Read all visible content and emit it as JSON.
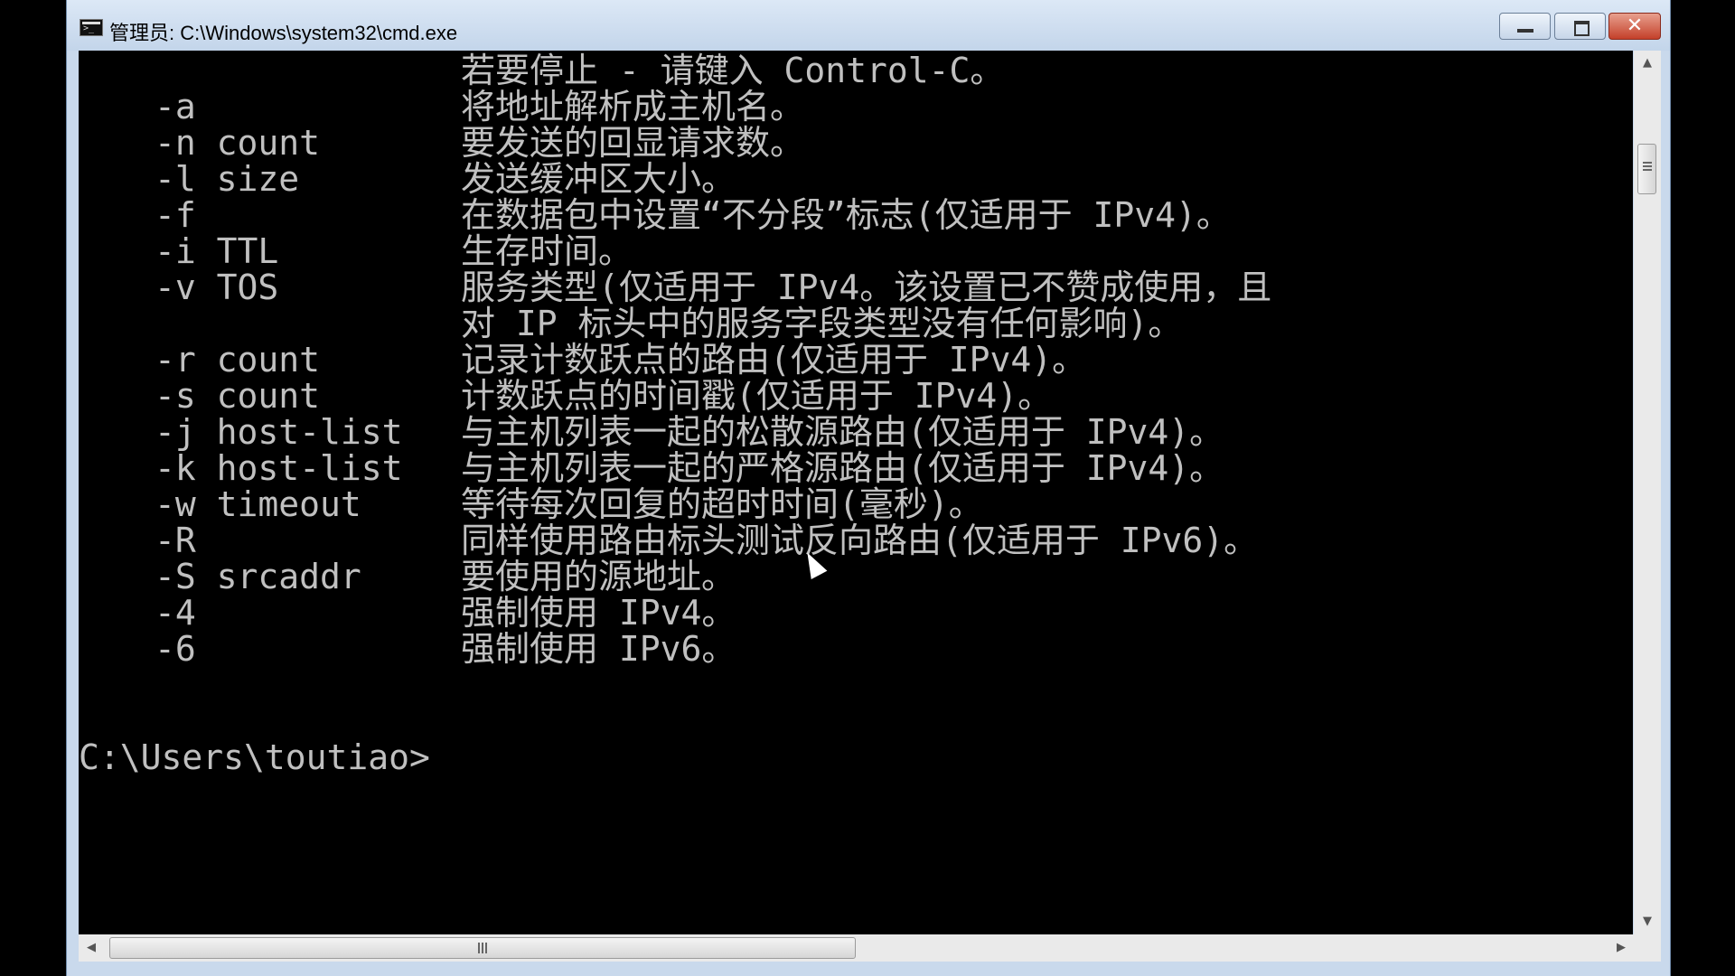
{
  "window": {
    "title": "管理员: C:\\Windows\\system32\\cmd.exe",
    "controls": {
      "minimize": "—",
      "maximize": "□",
      "close": "✕"
    },
    "icon": "console-icon"
  },
  "console": {
    "intro": "若要停止 - 请键入 Control-C。",
    "options": [
      {
        "opt": "-a",
        "desc": "将地址解析成主机名。"
      },
      {
        "opt": "-n count",
        "desc": "要发送的回显请求数。"
      },
      {
        "opt": "-l size",
        "desc": "发送缓冲区大小。"
      },
      {
        "opt": "-f",
        "desc": "在数据包中设置“不分段”标志(仅适用于 IPv4)。"
      },
      {
        "opt": "-i TTL",
        "desc": "生存时间。"
      },
      {
        "opt": "-v TOS",
        "desc": "服务类型(仅适用于 IPv4。该设置已不赞成使用，且"
      },
      {
        "opt": "",
        "desc": "对 IP 标头中的服务字段类型没有任何影响)。"
      },
      {
        "opt": "-r count",
        "desc": "记录计数跃点的路由(仅适用于 IPv4)。"
      },
      {
        "opt": "-s count",
        "desc": "计数跃点的时间戳(仅适用于 IPv4)。"
      },
      {
        "opt": "-j host-list",
        "desc": "与主机列表一起的松散源路由(仅适用于 IPv4)。"
      },
      {
        "opt": "-k host-list",
        "desc": "与主机列表一起的严格源路由(仅适用于 IPv4)。"
      },
      {
        "opt": "-w timeout",
        "desc": "等待每次回复的超时时间(毫秒)。"
      },
      {
        "opt": "-R",
        "desc": "同样使用路由标头测试反向路由(仅适用于 IPv6)。"
      },
      {
        "opt": "-S srcaddr",
        "desc": "要使用的源地址。"
      },
      {
        "opt": "-4",
        "desc": "强制使用 IPv4。"
      },
      {
        "opt": "-6",
        "desc": "强制使用 IPv6。"
      }
    ],
    "prompt": "C:\\Users\\toutiao>"
  },
  "scrollbars": {
    "up": "▲",
    "down": "▼",
    "left": "◀",
    "right": "▶"
  }
}
